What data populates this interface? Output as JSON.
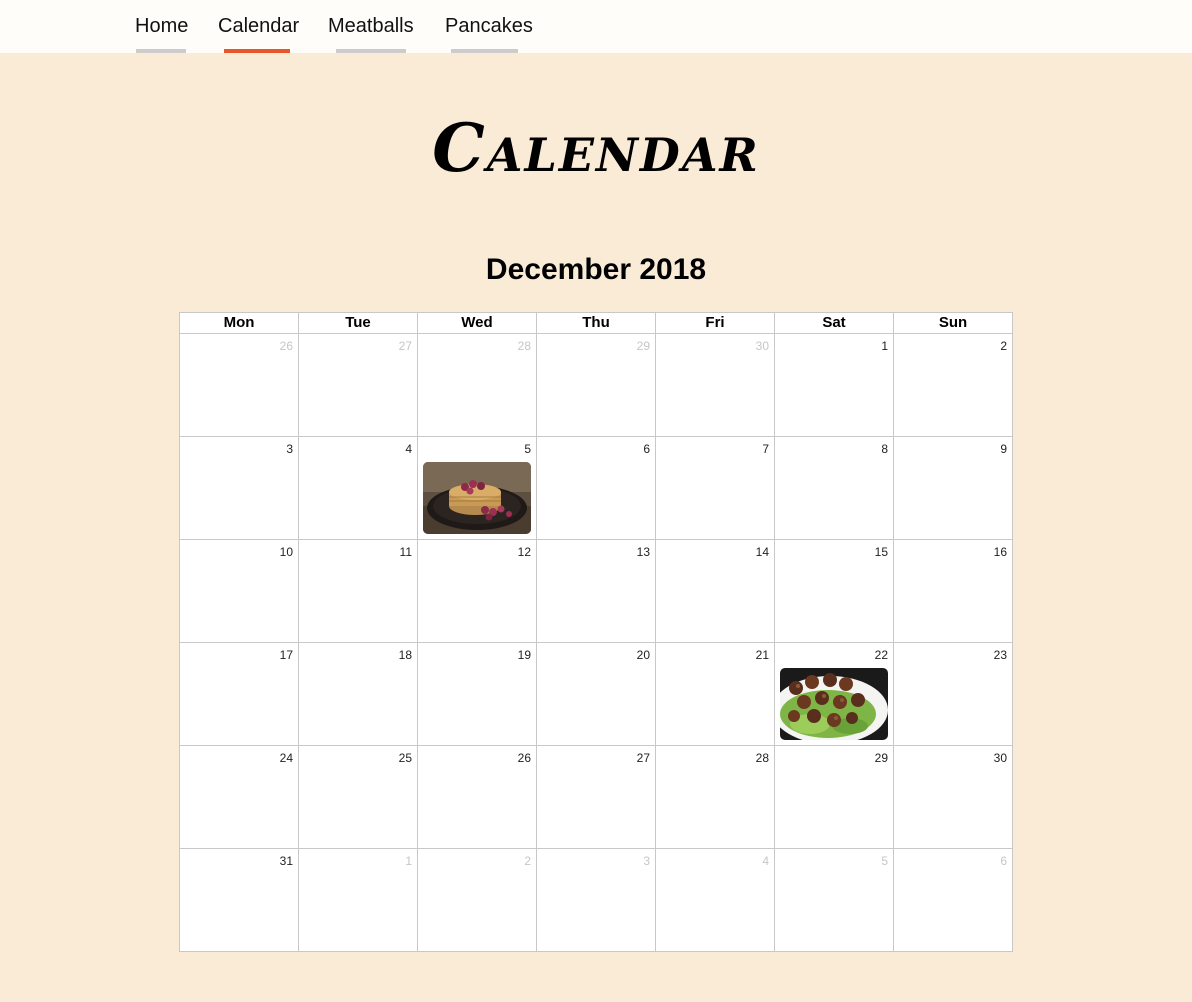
{
  "nav": {
    "items": [
      {
        "label": "Home",
        "active": false
      },
      {
        "label": "Calendar",
        "active": true
      },
      {
        "label": "Meatballs",
        "active": false
      },
      {
        "label": "Pancakes",
        "active": false
      }
    ]
  },
  "page_title": "Calendar",
  "month_title": "December 2018",
  "weekdays": [
    "Mon",
    "Tue",
    "Wed",
    "Thu",
    "Fri",
    "Sat",
    "Sun"
  ],
  "weeks": [
    [
      {
        "d": "26",
        "other": true
      },
      {
        "d": "27",
        "other": true
      },
      {
        "d": "28",
        "other": true
      },
      {
        "d": "29",
        "other": true
      },
      {
        "d": "30",
        "other": true
      },
      {
        "d": "1"
      },
      {
        "d": "2"
      }
    ],
    [
      {
        "d": "3"
      },
      {
        "d": "4"
      },
      {
        "d": "5",
        "image": "pancakes-photo"
      },
      {
        "d": "6"
      },
      {
        "d": "7"
      },
      {
        "d": "8"
      },
      {
        "d": "9"
      }
    ],
    [
      {
        "d": "10"
      },
      {
        "d": "11"
      },
      {
        "d": "12"
      },
      {
        "d": "13"
      },
      {
        "d": "14"
      },
      {
        "d": "15"
      },
      {
        "d": "16"
      }
    ],
    [
      {
        "d": "17"
      },
      {
        "d": "18"
      },
      {
        "d": "19"
      },
      {
        "d": "20"
      },
      {
        "d": "21"
      },
      {
        "d": "22",
        "image": "meatballs-photo"
      },
      {
        "d": "23"
      }
    ],
    [
      {
        "d": "24"
      },
      {
        "d": "25"
      },
      {
        "d": "26"
      },
      {
        "d": "27"
      },
      {
        "d": "28"
      },
      {
        "d": "29"
      },
      {
        "d": "30"
      }
    ],
    [
      {
        "d": "31"
      },
      {
        "d": "1",
        "other": true
      },
      {
        "d": "2",
        "other": true
      },
      {
        "d": "3",
        "other": true
      },
      {
        "d": "4",
        "other": true
      },
      {
        "d": "5",
        "other": true
      },
      {
        "d": "6",
        "other": true
      }
    ]
  ],
  "colors": {
    "page_background": "#faebd7",
    "nav_active_underline": "#e8562a",
    "nav_underline": "#cccccc",
    "other_month_day": "#c6c6c6"
  }
}
